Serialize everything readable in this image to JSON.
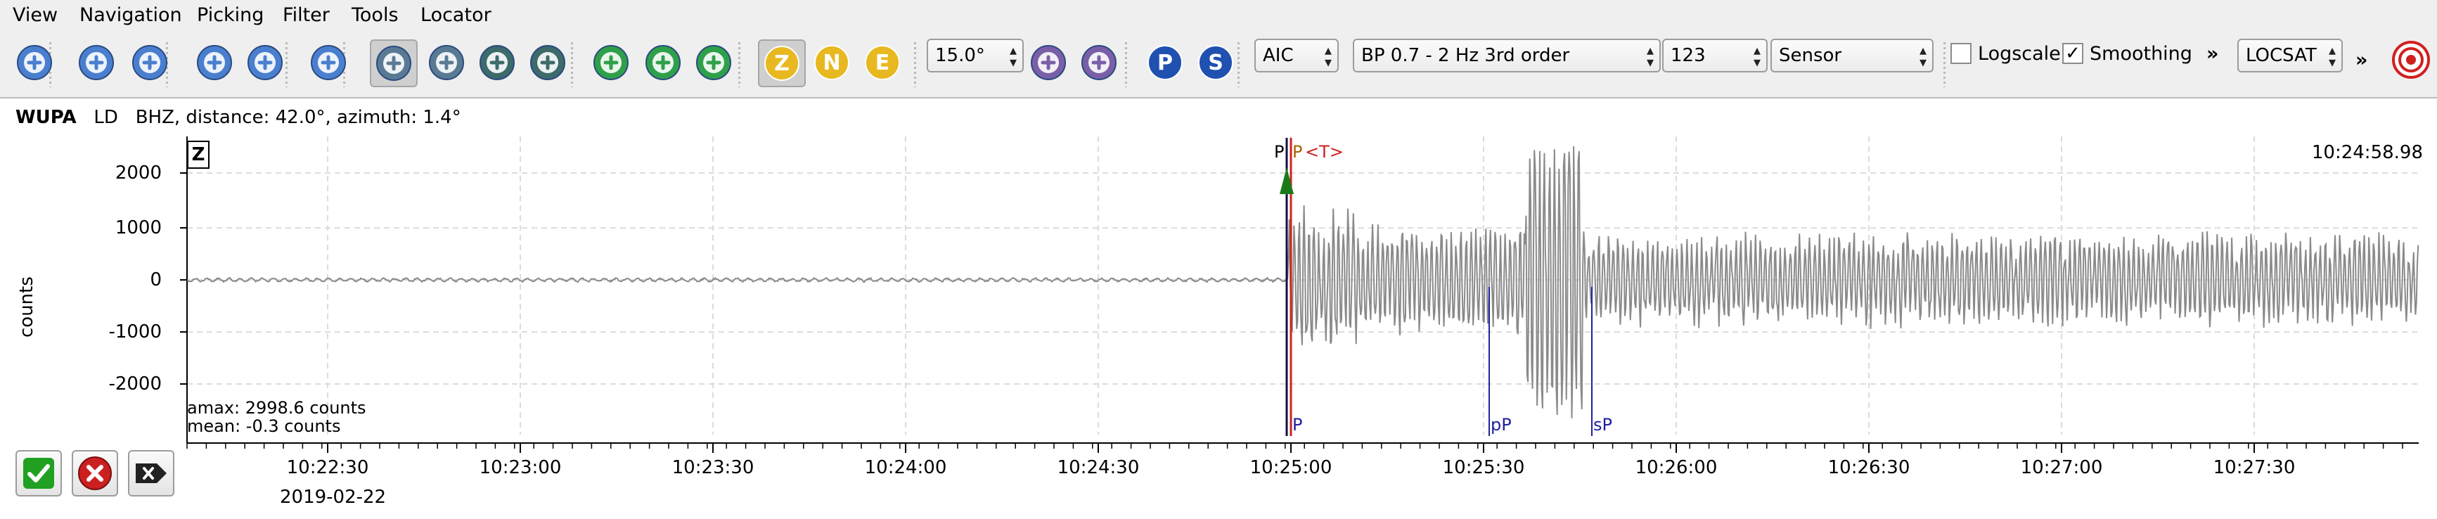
{
  "menubar": {
    "items": [
      "View",
      "Navigation",
      "Picking",
      "Filter",
      "Tools",
      "Locator"
    ],
    "mnemonics": [
      "V",
      "N",
      "P",
      "F",
      "T",
      "L"
    ]
  },
  "toolbar": {
    "buttons": [
      {
        "name": "home-icon",
        "color": "#4a7fd0"
      },
      {
        "name": "prev-trace-icon",
        "color": "#4a7fd0"
      },
      {
        "name": "next-trace-icon",
        "color": "#4a7fd0"
      },
      {
        "name": "scroll-left-icon",
        "color": "#4a7fd0"
      },
      {
        "name": "scroll-right-icon",
        "color": "#4a7fd0"
      },
      {
        "name": "align-icon",
        "color": "#4a7fd0"
      },
      {
        "name": "pick-mode-icon",
        "color": "#5a7a94"
      },
      {
        "name": "measure-icon",
        "color": "#5a7a94"
      },
      {
        "name": "station-map-icon",
        "color": "#3d6a6a"
      },
      {
        "name": "origin-icon",
        "color": "#3d6a6a"
      },
      {
        "name": "pick-p-icon",
        "color": "#2fa04a"
      },
      {
        "name": "pick-s-icon",
        "color": "#2fa04a"
      },
      {
        "name": "pick-relocate-icon",
        "color": "#2fa04a"
      },
      {
        "name": "component-z-button",
        "text": "Z",
        "color": "#e8b820"
      },
      {
        "name": "component-n-button",
        "text": "N",
        "color": "#e8b820"
      },
      {
        "name": "component-e-button",
        "text": "E",
        "color": "#e8b820"
      },
      {
        "name": "rotate-left-icon",
        "color": "#7a5fa8"
      },
      {
        "name": "rotate-right-icon",
        "color": "#7a5fa8"
      },
      {
        "name": "phase-p-button",
        "text": "P",
        "color": "#2050b0"
      },
      {
        "name": "phase-s-button",
        "text": "S",
        "color": "#2050b0"
      }
    ],
    "spin_value": "15.0°",
    "picker": "AIC",
    "filter": "BP 0.7 - 2 Hz  3rd order",
    "filter_order": "123",
    "units": "Sensor",
    "logscale_label": "Logscale",
    "logscale_checked": false,
    "smoothing_label": "Smoothing",
    "smoothing_checked": true,
    "overflow_glyph": "»",
    "locator": "LOCSAT",
    "overflow_glyph_2": "»"
  },
  "trace": {
    "station": "WUPA",
    "network": "LD",
    "info": "BHZ, distance: 42.0°, azimuth: 1.4°",
    "component_box": "Z",
    "start_time": "10:24:58.98",
    "y_axis_label": "counts",
    "y_ticks": [
      "2000",
      "1000",
      "0",
      "-1000",
      "-2000"
    ],
    "x_ticks": [
      "10:22:30",
      "10:23:00",
      "10:23:30",
      "10:24:00",
      "10:24:30",
      "10:25:00",
      "10:25:30",
      "10:26:00",
      "10:26:30",
      "10:27:00",
      "10:27:30"
    ],
    "date": "2019-02-22",
    "amax": "amax: 2998.6 counts",
    "mean": "mean: -0.3 counts",
    "pick_top_label_1": "P",
    "pick_top_label_2": "P",
    "pick_top_label_3": "<T>",
    "theoretical_phases": [
      "P",
      "pP",
      "sP"
    ],
    "trace_color": "#8a8a8a",
    "pick_color": "#1a7a1a",
    "theoretical_color": "#2020a0",
    "manual_pick_color": "#d02020"
  },
  "bottom_buttons": [
    {
      "name": "accept-button",
      "color": "#22a022"
    },
    {
      "name": "reject-button",
      "color": "#cc2020"
    },
    {
      "name": "apply-next-button",
      "color": "#222222"
    }
  ]
}
